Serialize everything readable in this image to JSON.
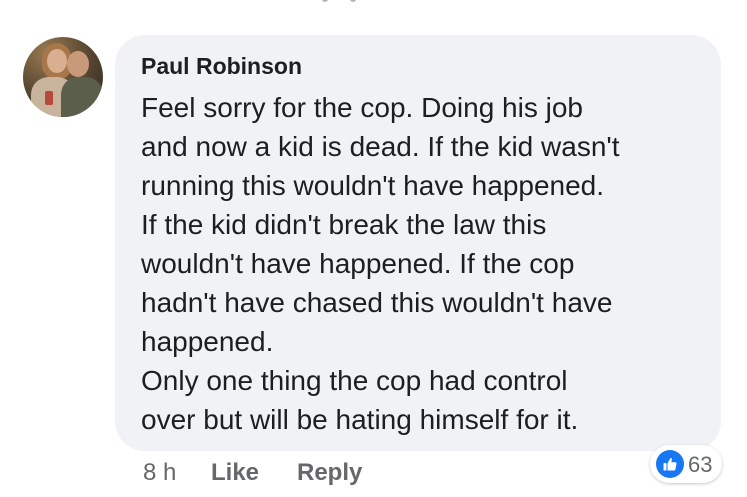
{
  "comment": {
    "author": "Paul Robinson",
    "lines": [
      "Feel sorry for the cop. Doing his job",
      "and now a kid is dead. If the kid wasn't",
      "running this wouldn't have happened.",
      "If the kid didn't break the law this",
      "wouldn't have happened. If the cop",
      "hadn't have chased this wouldn't have",
      "happened.",
      "Only one thing the cop had control",
      "over but will be hating himself for it."
    ],
    "timestamp": "8 h",
    "like_label": "Like",
    "reply_label": "Reply",
    "reaction_count": "63",
    "reaction_icon": "thumbs-up-icon"
  },
  "colors": {
    "bubble": "#f0f2f5",
    "text": "#1c1e21",
    "secondary": "#65676b",
    "like_blue": "#1877f2"
  }
}
